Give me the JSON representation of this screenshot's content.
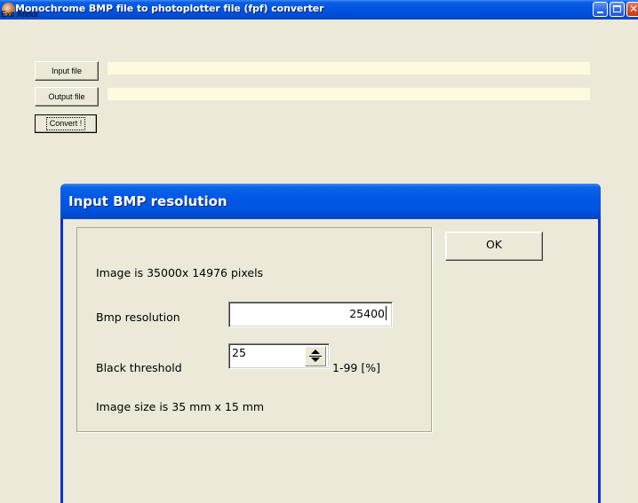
{
  "window": {
    "title": "Monochrome BMP file to photoplotter file (fpf) converter",
    "menu": [
      "Exit",
      "About"
    ],
    "input_file_button": "Input file",
    "output_file_button": "Output file",
    "convert_button": "Convert !",
    "input_file_value": "",
    "output_file_value": ""
  },
  "dialog": {
    "title": "Input BMP resolution",
    "image_pixels_text": "Image is 35000x 14976 pixels",
    "bmp_resolution_label": "Bmp resolution",
    "bmp_resolution_value": "25400",
    "black_threshold_label": "Black threshold",
    "black_threshold_value": "25",
    "threshold_range": "1-99 [%]",
    "image_size_text": "Image size is 35 mm  x 15 mm",
    "ok_button": "OK"
  },
  "colors": {
    "titlebar_blue": "#0054e3",
    "window_bg": "#ece9d8",
    "path_field_bg": "#fdfadf"
  }
}
